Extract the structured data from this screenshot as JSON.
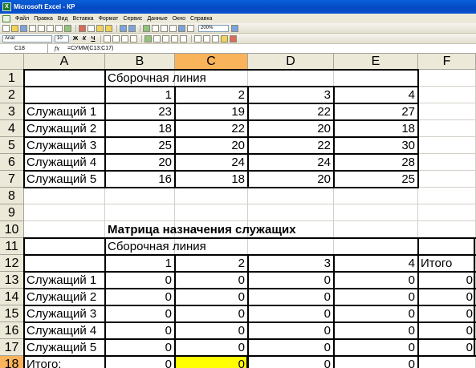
{
  "window": {
    "title": "Microsoft Excel - КР"
  },
  "menu": [
    "Файл",
    "Правка",
    "Вид",
    "Вставка",
    "Формат",
    "Сервис",
    "Данные",
    "Окно",
    "Справка"
  ],
  "toolbar": {
    "zoom": "200%",
    "font_name": "Arial",
    "font_size": "10",
    "bold": "Ж",
    "italic": "К",
    "underline": "Ч"
  },
  "formula_bar": {
    "name_box": "C18",
    "fx": "fx",
    "formula": "=СУММ(C13:C17)"
  },
  "columns": [
    "A",
    "B",
    "C",
    "D",
    "E",
    "F"
  ],
  "rows": [
    "1",
    "2",
    "3",
    "4",
    "5",
    "6",
    "7",
    "8",
    "9",
    "10",
    "11",
    "12",
    "13",
    "14",
    "15",
    "16",
    "17",
    "18"
  ],
  "cells": {
    "r1": {
      "B": "Сборочная линия"
    },
    "r2": {
      "B": "1",
      "C": "2",
      "D": "3",
      "E": "4"
    },
    "r3": {
      "A": "Служащий 1",
      "B": "23",
      "C": "19",
      "D": "22",
      "E": "27"
    },
    "r4": {
      "A": "Служащий 2",
      "B": "18",
      "C": "22",
      "D": "20",
      "E": "18"
    },
    "r5": {
      "A": "Служащий 3",
      "B": "25",
      "C": "20",
      "D": "22",
      "E": "30"
    },
    "r6": {
      "A": "Служащий 4",
      "B": "20",
      "C": "24",
      "D": "24",
      "E": "28"
    },
    "r7": {
      "A": "Служащий 5",
      "B": "16",
      "C": "18",
      "D": "20",
      "E": "25"
    },
    "r10": {
      "B": "Матрица назначения служащих"
    },
    "r11": {
      "B": "Сборочная линия"
    },
    "r12": {
      "B": "1",
      "C": "2",
      "D": "3",
      "E": "4",
      "F": "Итого"
    },
    "r13": {
      "A": "Служащий 1",
      "B": "0",
      "C": "0",
      "D": "0",
      "E": "0",
      "F": "0"
    },
    "r14": {
      "A": "Служащий 2",
      "B": "0",
      "C": "0",
      "D": "0",
      "E": "0",
      "F": "0"
    },
    "r15": {
      "A": "Служащий 3",
      "B": "0",
      "C": "0",
      "D": "0",
      "E": "0",
      "F": "0"
    },
    "r16": {
      "A": "Служащий 4",
      "B": "0",
      "C": "0",
      "D": "0",
      "E": "0",
      "F": "0"
    },
    "r17": {
      "A": "Служащий 5",
      "B": "0",
      "C": "0",
      "D": "0",
      "E": "0",
      "F": "0"
    },
    "r18": {
      "A": "Итого:",
      "B": "0",
      "C": "0",
      "D": "0",
      "E": "0"
    }
  },
  "selected_cell": "C18",
  "colors": {
    "title_bar": "#0349c3",
    "selected_header": "#f9b35a",
    "highlight_cell": "#ffff00"
  }
}
